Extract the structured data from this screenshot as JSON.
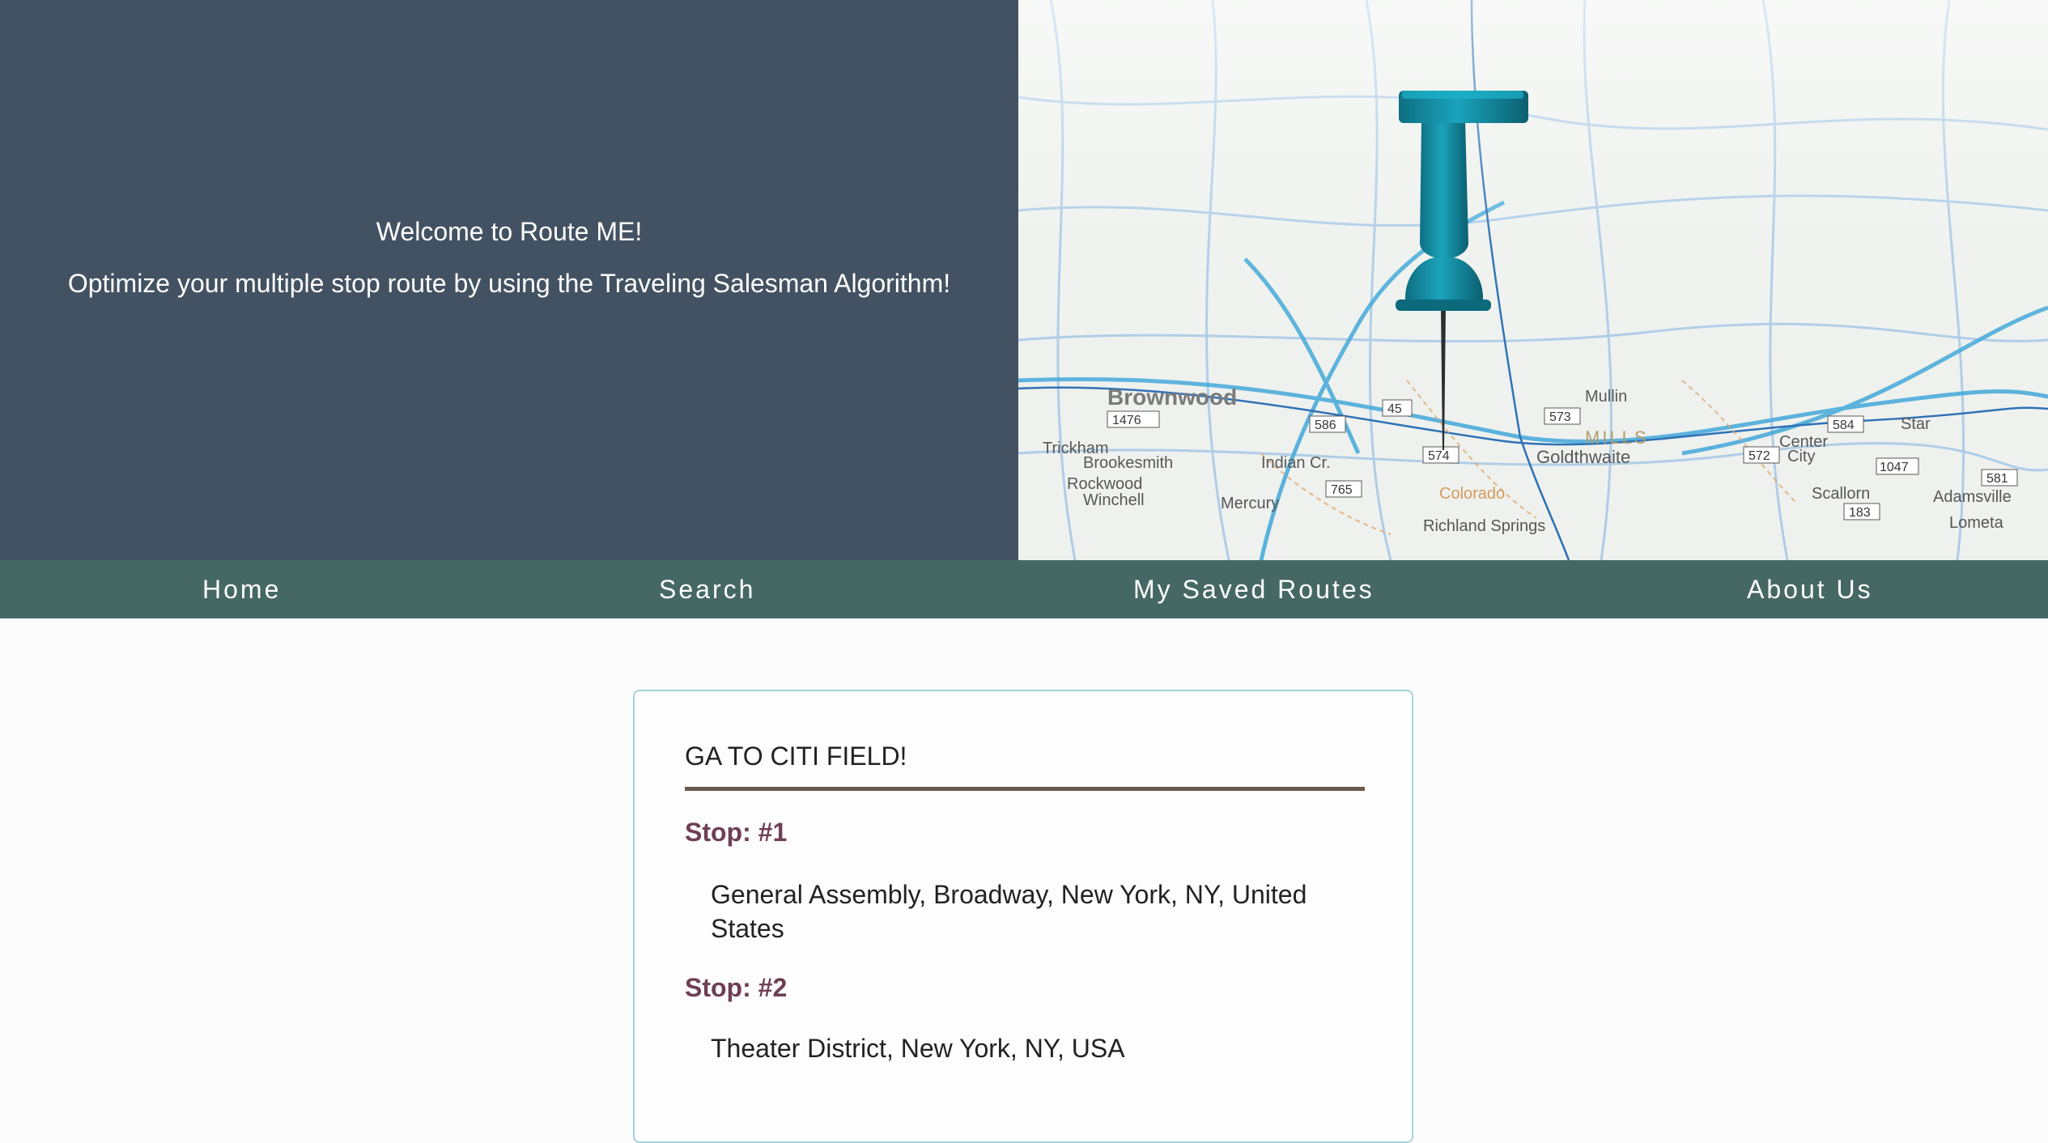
{
  "hero": {
    "welcome": "Welcome to Route ME!",
    "tagline": "Optimize your multiple stop route by using the Traveling Salesman Algorithm!",
    "map_labels": [
      "Brownwood",
      "Brookesmith",
      "Indian Cr.",
      "Rockwood",
      "Winchell",
      "Mercury",
      "Trickham",
      "Goldthwaite",
      "MILLS",
      "Center City",
      "Star",
      "Scallorn",
      "Mullin",
      "Adamsville",
      "Lometa",
      "Colorado",
      "Richland Springs"
    ],
    "route_shields": [
      "574",
      "573",
      "572",
      "584",
      "1047",
      "183",
      "765",
      "586",
      "45",
      "1476",
      "581"
    ],
    "pin_color": "#1797ad"
  },
  "nav": {
    "home": "Home",
    "search": "Search",
    "saved": "My Saved Routes",
    "about": "About Us"
  },
  "route": {
    "title": "GA TO CITI FIELD!",
    "stops": [
      {
        "label": "Stop: #1",
        "address": "General Assembly, Broadway, New York, NY, United States"
      },
      {
        "label": "Stop: #2",
        "address": "Theater District, New York, NY, USA"
      }
    ]
  },
  "colors": {
    "hero_panel": "#435262",
    "navbar": "#466865",
    "stop_label": "#6e3f55",
    "card_border": "#a6d3d9",
    "title_rule": "#6b5a4f"
  }
}
